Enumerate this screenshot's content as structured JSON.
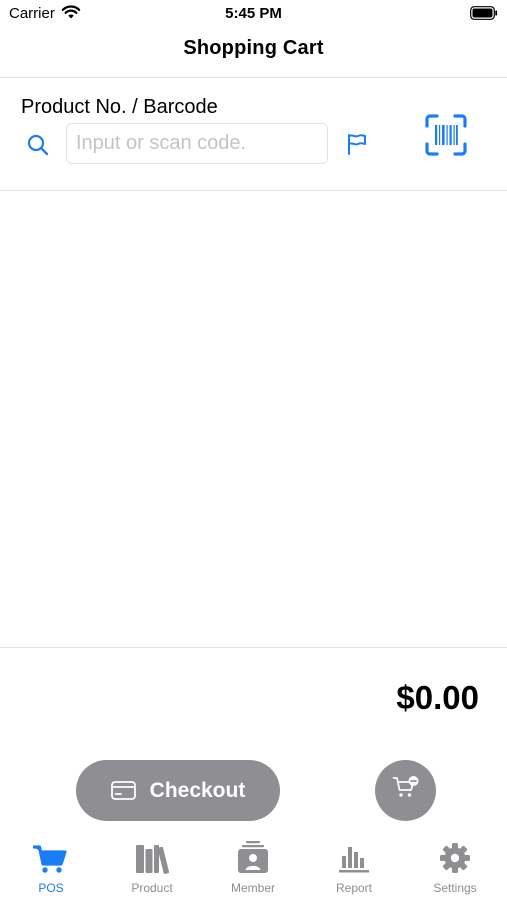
{
  "status_bar": {
    "carrier": "Carrier",
    "time": "5:45 PM"
  },
  "nav": {
    "title": "Shopping Cart"
  },
  "search": {
    "label": "Product No. / Barcode",
    "placeholder": "Input or scan code.",
    "value": ""
  },
  "cart": {
    "total": "$0.00",
    "items": []
  },
  "actions": {
    "checkout_label": "Checkout"
  },
  "tabs": [
    {
      "label": "POS",
      "icon": "cart-icon",
      "active": true
    },
    {
      "label": "Product",
      "icon": "books-icon",
      "active": false
    },
    {
      "label": "Member",
      "icon": "member-card-icon",
      "active": false
    },
    {
      "label": "Report",
      "icon": "bar-chart-icon",
      "active": false
    },
    {
      "label": "Settings",
      "icon": "gear-icon",
      "active": false
    }
  ],
  "colors": {
    "accent": "#1a7df5",
    "inactive": "#8e8e93",
    "button": "#8e8e93"
  }
}
